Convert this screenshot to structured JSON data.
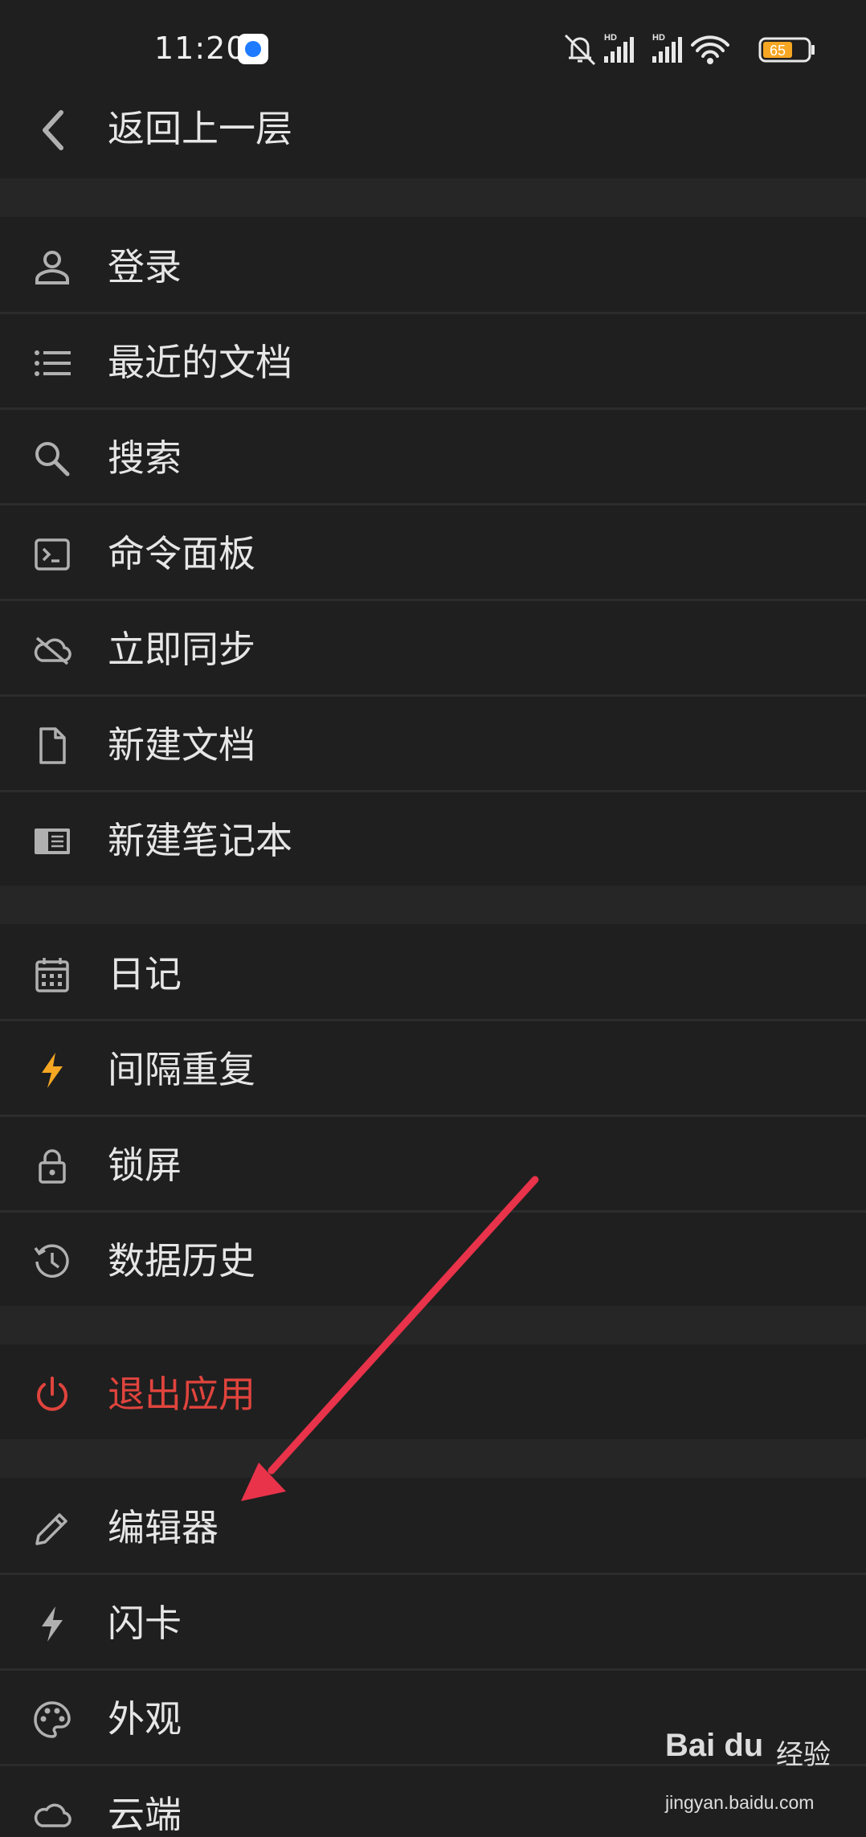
{
  "status_bar": {
    "time": "11:20",
    "battery": "65",
    "network_label_1": "HD",
    "network_label_2": "HD"
  },
  "header": {
    "back_label": "返回上一层"
  },
  "menu": {
    "group1": [
      {
        "label": "登录",
        "icon": "person-icon"
      },
      {
        "label": "最近的文档",
        "icon": "list-icon"
      },
      {
        "label": "搜索",
        "icon": "search-icon"
      },
      {
        "label": "命令面板",
        "icon": "terminal-icon"
      },
      {
        "label": "立即同步",
        "icon": "cloud-off-icon"
      },
      {
        "label": "新建文档",
        "icon": "file-icon"
      },
      {
        "label": "新建笔记本",
        "icon": "notebook-icon"
      }
    ],
    "group2": [
      {
        "label": "日记",
        "icon": "calendar-icon"
      },
      {
        "label": "间隔重复",
        "icon": "lightning-icon"
      },
      {
        "label": "锁屏",
        "icon": "lock-icon"
      },
      {
        "label": "数据历史",
        "icon": "history-icon"
      }
    ],
    "exit": {
      "label": "退出应用",
      "icon": "power-icon"
    },
    "group3": [
      {
        "label": "编辑器",
        "icon": "pencil-icon"
      },
      {
        "label": "闪卡",
        "icon": "flash-icon"
      },
      {
        "label": "外观",
        "icon": "palette-icon"
      },
      {
        "label": "云端",
        "icon": "cloud-icon"
      }
    ]
  },
  "watermark": {
    "brand": "Bai du",
    "cn": "经验",
    "url": "jingyan.baidu.com"
  },
  "colors": {
    "background": "#1f1f1f",
    "text": "#e6e6e6",
    "icon": "#b0b0b0",
    "danger": "#e0443d",
    "accent_lightning": "#f5a623",
    "annotation_arrow": "#e8334a"
  }
}
